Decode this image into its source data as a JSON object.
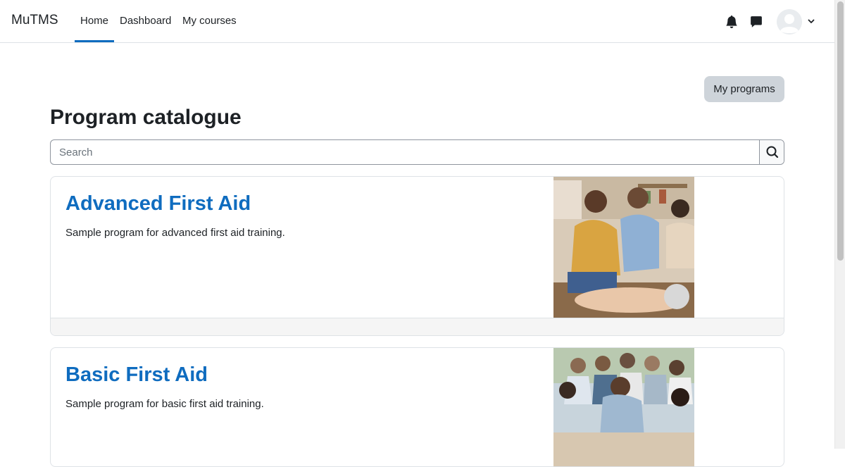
{
  "navbar": {
    "brand": "MuTMS",
    "links": [
      "Home",
      "Dashboard",
      "My courses"
    ],
    "active_link": "Home",
    "icons": [
      "bell-icon",
      "chat-icon",
      "user-avatar",
      "chevron-down-icon"
    ]
  },
  "page": {
    "my_programs_label": "My programs",
    "title": "Program catalogue",
    "search_placeholder": "Search"
  },
  "programs": [
    {
      "title": "Advanced First Aid",
      "description": "Sample program for advanced first aid training."
    },
    {
      "title": "Basic First Aid",
      "description": "Sample program for basic first aid training."
    }
  ],
  "colors": {
    "accent": "#0f6cbf",
    "button_bg": "#ced4da",
    "border": "#dee2e6"
  }
}
